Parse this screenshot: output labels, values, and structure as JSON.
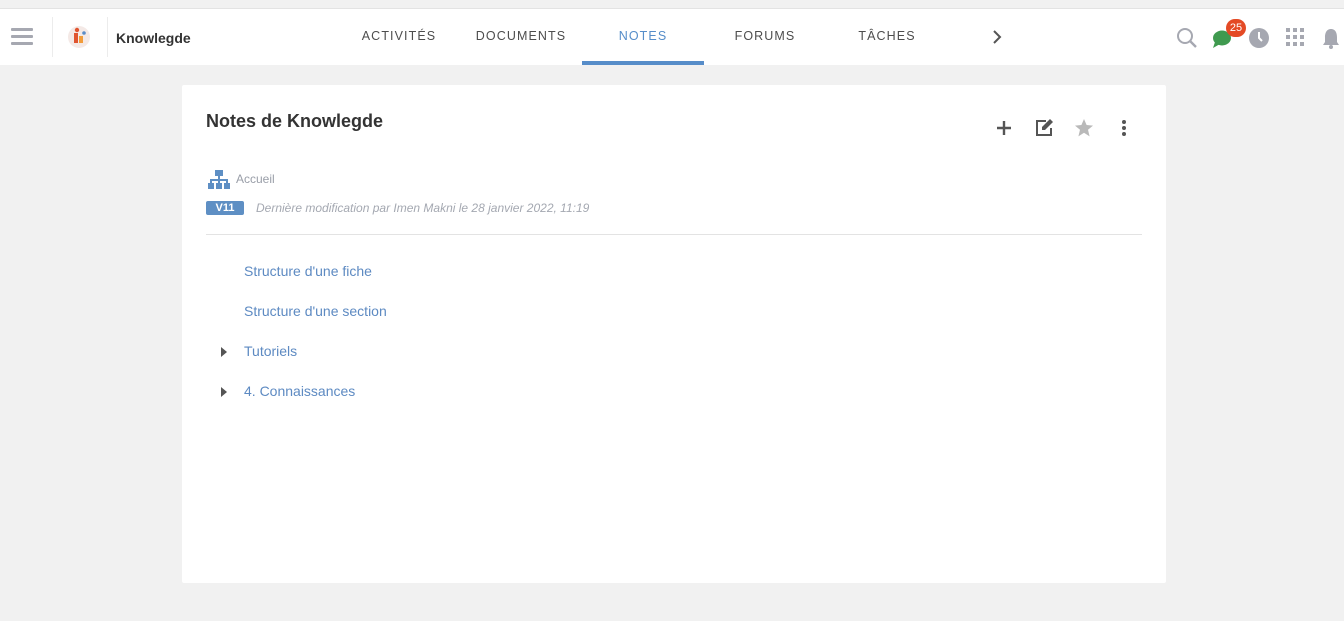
{
  "header": {
    "space_name": "Knowlegde",
    "tabs": [
      {
        "label": "ACTIVITÉS",
        "active": false
      },
      {
        "label": "DOCUMENTS",
        "active": false
      },
      {
        "label": "NOTES",
        "active": true
      },
      {
        "label": "FORUMS",
        "active": false
      },
      {
        "label": "TÂCHES",
        "active": false
      }
    ],
    "icons": [
      "menu-icon",
      "space-logo",
      "chevron-right-icon",
      "search-icon",
      "chat-icon",
      "clock-icon",
      "apps-grid-icon",
      "bell-icon"
    ],
    "chat_badge": "25",
    "accent_color": "#578dc9",
    "badge_color": "#e44a25",
    "chat_icon_color": "#3f9a4f"
  },
  "notes": {
    "title": "Notes de Knowlegde",
    "actions": [
      "add-icon",
      "edit-icon",
      "star-icon",
      "more-vertical-icon"
    ],
    "breadcrumb": "Accueil",
    "version": "V11",
    "last_modified": "Dernière modification par Imen Makni le 28 janvier 2022, 11:19",
    "tree": [
      {
        "label": "Structure d'une fiche",
        "has_children": false
      },
      {
        "label": "Structure d'une section",
        "has_children": false
      },
      {
        "label": "Tutoriels",
        "has_children": true
      },
      {
        "label": "4. Connaissances",
        "has_children": true
      }
    ],
    "link_color": "#5d8ac2",
    "version_color": "#5e8fc4"
  }
}
